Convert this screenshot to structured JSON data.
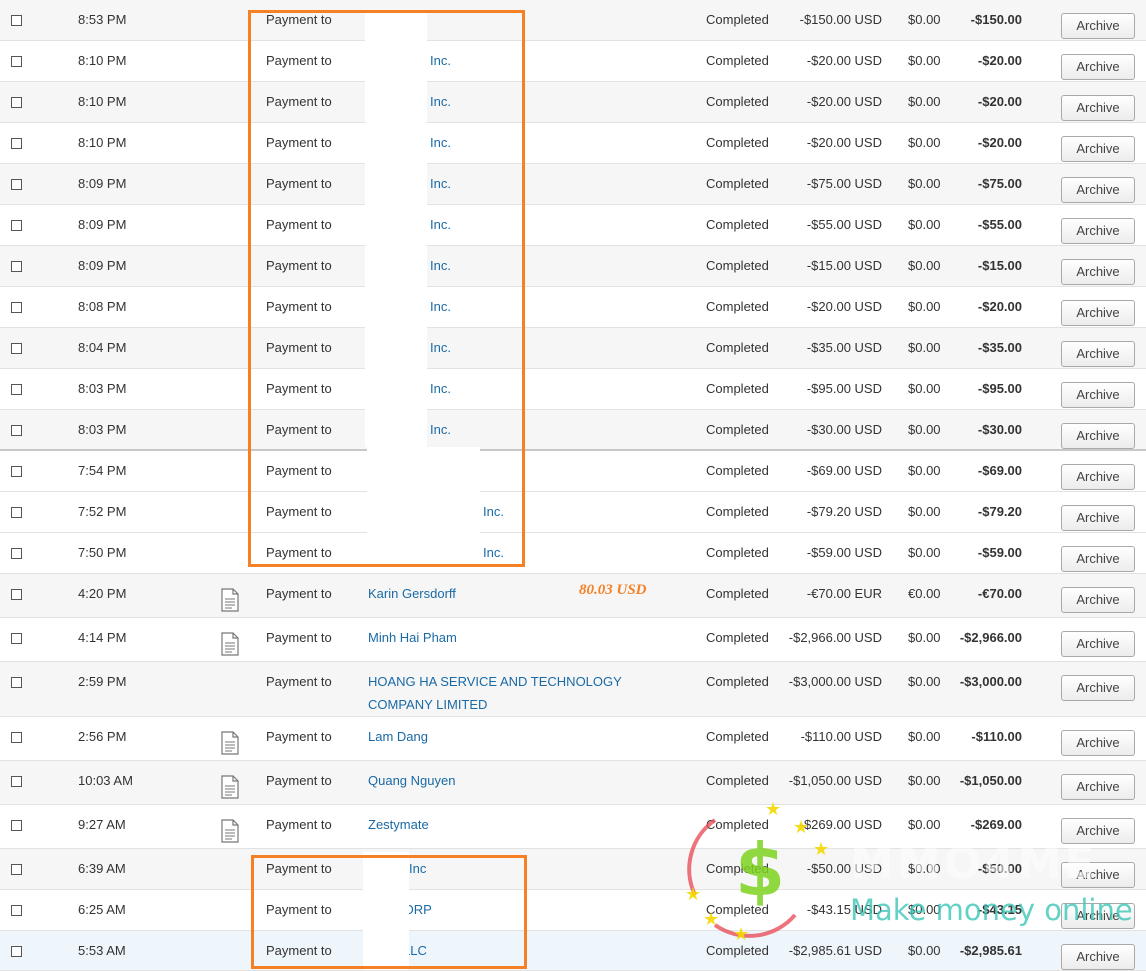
{
  "annotation_note": "80.03 USD",
  "watermark": {
    "brand": "MMO4ME",
    "tagline": "Make money online"
  },
  "archive_label": "Archive",
  "colors": {
    "accent": "#f58025",
    "link": "#1a6aa6"
  },
  "transactions": [
    {
      "time": "8:53 PM",
      "type": "Payment to",
      "name": "",
      "status": "Completed",
      "gross": "-$150.00 USD",
      "fee": "$0.00",
      "net": "-$150.00"
    },
    {
      "time": "8:10 PM",
      "type": "Payment to",
      "name": "Inc.",
      "status": "Completed",
      "gross": "-$20.00 USD",
      "fee": "$0.00",
      "net": "-$20.00"
    },
    {
      "time": "8:10 PM",
      "type": "Payment to",
      "name": "Inc.",
      "status": "Completed",
      "gross": "-$20.00 USD",
      "fee": "$0.00",
      "net": "-$20.00"
    },
    {
      "time": "8:10 PM",
      "type": "Payment to",
      "name": "Inc.",
      "status": "Completed",
      "gross": "-$20.00 USD",
      "fee": "$0.00",
      "net": "-$20.00"
    },
    {
      "time": "8:09 PM",
      "type": "Payment to",
      "name": "Inc.",
      "status": "Completed",
      "gross": "-$75.00 USD",
      "fee": "$0.00",
      "net": "-$75.00"
    },
    {
      "time": "8:09 PM",
      "type": "Payment to",
      "name": "Inc.",
      "status": "Completed",
      "gross": "-$55.00 USD",
      "fee": "$0.00",
      "net": "-$55.00"
    },
    {
      "time": "8:09 PM",
      "type": "Payment to",
      "name": "Inc.",
      "status": "Completed",
      "gross": "-$15.00 USD",
      "fee": "$0.00",
      "net": "-$15.00"
    },
    {
      "time": "8:08 PM",
      "type": "Payment to",
      "name": "Inc.",
      "status": "Completed",
      "gross": "-$20.00 USD",
      "fee": "$0.00",
      "net": "-$20.00"
    },
    {
      "time": "8:04 PM",
      "type": "Payment to",
      "name": "Inc.",
      "status": "Completed",
      "gross": "-$35.00 USD",
      "fee": "$0.00",
      "net": "-$35.00"
    },
    {
      "time": "8:03 PM",
      "type": "Payment to",
      "name": "Inc.",
      "status": "Completed",
      "gross": "-$95.00 USD",
      "fee": "$0.00",
      "net": "-$95.00"
    },
    {
      "time": "8:03 PM",
      "type": "Payment to",
      "name": "Inc.",
      "status": "Completed",
      "gross": "-$30.00 USD",
      "fee": "$0.00",
      "net": "-$30.00"
    },
    {
      "time": "7:54 PM",
      "type": "Payment to",
      "name": "",
      "status": "Completed",
      "gross": "-$69.00 USD",
      "fee": "$0.00",
      "net": "-$69.00"
    },
    {
      "time": "7:52 PM",
      "type": "Payment to",
      "name": "Inc.",
      "status": "Completed",
      "gross": "-$79.20 USD",
      "fee": "$0.00",
      "net": "-$79.20"
    },
    {
      "time": "7:50 PM",
      "type": "Payment to",
      "name": "Inc.",
      "status": "Completed",
      "gross": "-$59.00 USD",
      "fee": "$0.00",
      "net": "-$59.00"
    },
    {
      "time": "4:20 PM",
      "type": "Payment to",
      "name": "Karin Gersdorff",
      "status": "Completed",
      "gross": "-€70.00 EUR",
      "fee": "€0.00",
      "net": "-€70.00",
      "doc_icon": "document-icon"
    },
    {
      "time": "4:14 PM",
      "type": "Payment to",
      "name": "Minh Hai Pham",
      "status": "Completed",
      "gross": "-$2,966.00 USD",
      "fee": "$0.00",
      "net": "-$2,966.00",
      "doc_icon": "document-icon"
    },
    {
      "time": "2:59 PM",
      "type": "Payment to",
      "name": "HOANG HA SERVICE AND TECHNOLOGY",
      "name2": "COMPANY LIMITED",
      "status": "Completed",
      "gross": "-$3,000.00 USD",
      "fee": "$0.00",
      "net": "-$3,000.00"
    },
    {
      "time": "2:56 PM",
      "type": "Payment to",
      "name": "Lam Dang",
      "status": "Completed",
      "gross": "-$110.00 USD",
      "fee": "$0.00",
      "net": "-$110.00",
      "doc_icon": "document-icon"
    },
    {
      "time": "10:03 AM",
      "type": "Payment to",
      "name": "Quang Nguyen",
      "status": "Completed",
      "gross": "-$1,050.00 USD",
      "fee": "$0.00",
      "net": "-$1,050.00",
      "doc_icon": "document-icon"
    },
    {
      "time": "9:27 AM",
      "type": "Payment to",
      "name": "Zestymate",
      "status": "Completed",
      "gross": "-$269.00 USD",
      "fee": "$0.00",
      "net": "-$269.00",
      "doc_icon": "document-icon"
    },
    {
      "time": "6:39 AM",
      "type": "Payment to",
      "name": "Inc",
      "status": "Completed",
      "gross": "-$50.00 USD",
      "fee": "$0.00",
      "net": "-$50.00"
    },
    {
      "time": "6:25 AM",
      "type": "Payment to",
      "name": "E CORP",
      "status": "Completed",
      "gross": "-$43.15 USD",
      "fee": "$0.00",
      "net": "-$43.15"
    },
    {
      "time": "5:53 AM",
      "type": "Payment to",
      "name": "LLC",
      "status": "Completed",
      "gross": "-$2,985.61 USD",
      "fee": "$0.00",
      "net": "-$2,985.61"
    }
  ]
}
